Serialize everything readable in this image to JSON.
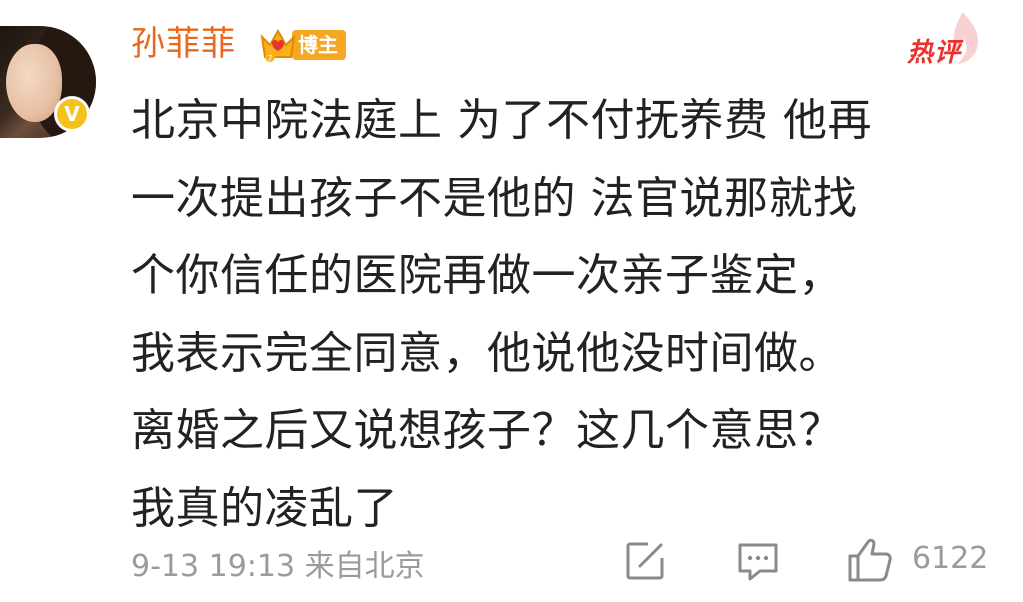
{
  "post": {
    "username": "孙菲菲",
    "badge_label": "博主",
    "hot_label": "热评",
    "content": "北京中院法庭上 为了不付抚养费 他再\n一次提出孩子不是他的 法官说那就找\n个你信任的医院再做一次亲子鉴定，\n我表示完全同意，他说他没时间做。\n离婚之后又说想孩子？这几个意思？\n我真的凌乱了",
    "timestamp": "9-13 19:13",
    "source": "来自北京",
    "like_count": "6122"
  },
  "icons": {
    "avatar": "avatar-photo",
    "verified": "verified-v-icon",
    "badge": "crown-badge-icon",
    "hot": "flame-icon",
    "share": "share-edit-icon",
    "comment": "comment-icon",
    "like": "thumbs-up-icon"
  },
  "colors": {
    "username": "#e8681d",
    "hot": "#e8322e",
    "badge": "#f5a623",
    "verified": "#f4c21b",
    "meta": "#9b9b9b",
    "text": "#222222"
  }
}
